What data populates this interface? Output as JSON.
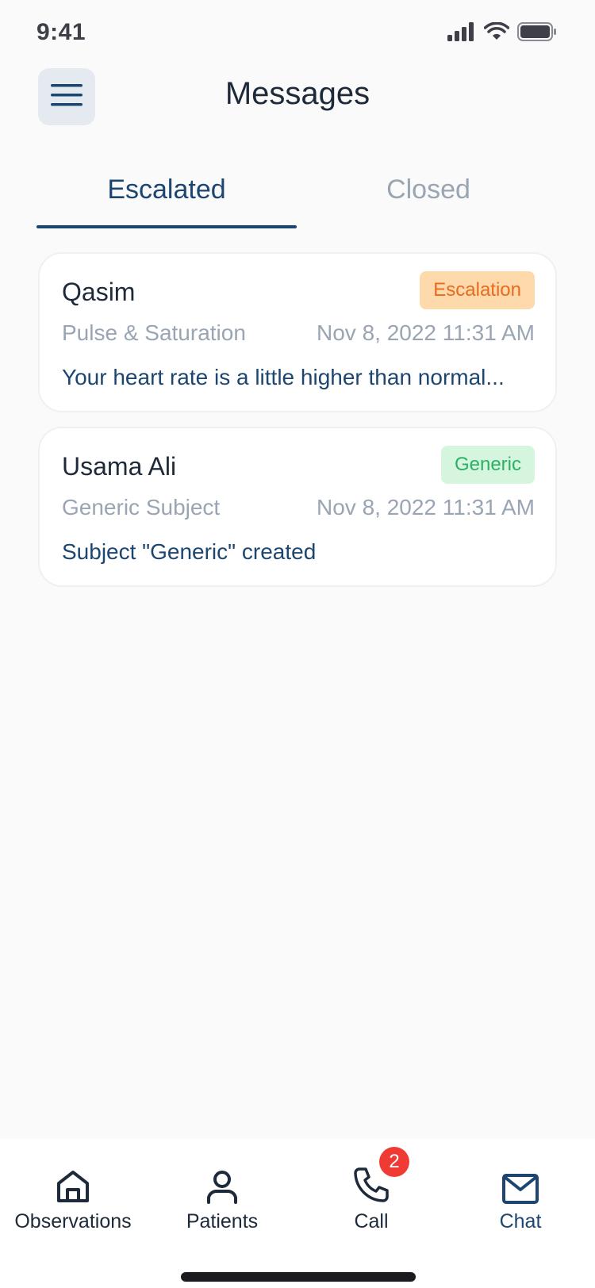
{
  "status_bar": {
    "time": "9:41"
  },
  "header": {
    "title": "Messages"
  },
  "tabs": [
    {
      "label": "Escalated",
      "active": true
    },
    {
      "label": "Closed",
      "active": false
    }
  ],
  "messages": [
    {
      "name": "Qasim",
      "badge": "Escalation",
      "subject": "Pulse & Saturation",
      "date": "Nov 8, 2022 11:31 AM",
      "preview": "Your heart rate is a little higher than normal..."
    },
    {
      "name": "Usama Ali",
      "badge": "Generic",
      "subject": "Generic Subject",
      "date": "Nov 8, 2022 11:31 AM",
      "preview": "Subject \"Generic\" created"
    }
  ],
  "bottom_nav": {
    "items": [
      {
        "label": "Observations",
        "icon": "home-icon"
      },
      {
        "label": "Patients",
        "icon": "person-icon"
      },
      {
        "label": "Call",
        "icon": "phone-icon",
        "badge": "2"
      },
      {
        "label": "Chat",
        "icon": "mail-icon",
        "active": true
      }
    ]
  },
  "colors": {
    "primary": "#1c4670",
    "muted": "#9aa5b4",
    "escalation_bg": "#fdd9ab",
    "escalation_text": "#ea6a1e",
    "generic_bg": "#d6f5df",
    "generic_text": "#2bb163",
    "badge_red": "#ef3b34"
  }
}
